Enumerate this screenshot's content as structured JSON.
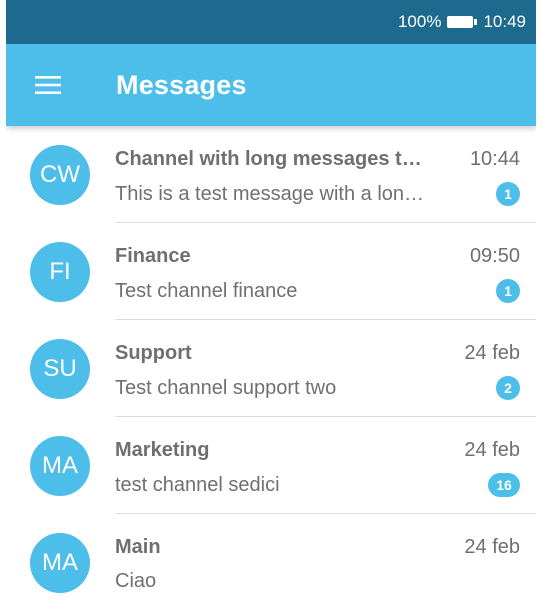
{
  "status_bar": {
    "battery_percent": "100%",
    "battery_icon": "battery-full-icon",
    "time": "10:49"
  },
  "app_bar": {
    "menu_icon": "hamburger-menu-icon",
    "title": "Messages"
  },
  "colors": {
    "status_bar": "#1e6a8e",
    "primary": "#4dbdea",
    "text_secondary": "#6f6f6f"
  },
  "channels": [
    {
      "initials": "CW",
      "name": "Channel with long messages t…",
      "time": "10:44",
      "preview": "This is a test message with a lon…",
      "unread": "1"
    },
    {
      "initials": "FI",
      "name": "Finance",
      "time": "09:50",
      "preview": "Test channel finance",
      "unread": "1"
    },
    {
      "initials": "SU",
      "name": "Support",
      "time": "24 feb",
      "preview": "Test channel support two",
      "unread": "2"
    },
    {
      "initials": "MA",
      "name": "Marketing",
      "time": "24 feb",
      "preview": "test channel sedici",
      "unread": "16"
    },
    {
      "initials": "MA",
      "name": "Main",
      "time": "24 feb",
      "preview": "Ciao",
      "unread": ""
    }
  ]
}
